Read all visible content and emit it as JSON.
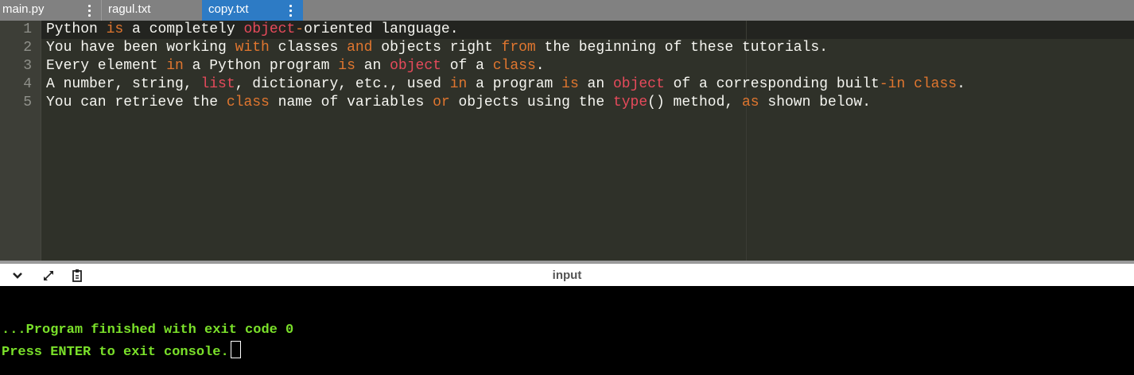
{
  "tabs": [
    {
      "label": "main.py",
      "active": false
    },
    {
      "label": "ragul.txt",
      "active": false
    },
    {
      "label": "copy.txt",
      "active": true
    }
  ],
  "editor": {
    "line_numbers": [
      "1",
      "2",
      "3",
      "4",
      "5"
    ],
    "lines": [
      [
        {
          "t": "Python ",
          "c": "txt"
        },
        {
          "t": "is",
          "c": "kw"
        },
        {
          "t": " a completely ",
          "c": "txt"
        },
        {
          "t": "object",
          "c": "fn"
        },
        {
          "t": "-",
          "c": "kw"
        },
        {
          "t": "oriented language.",
          "c": "txt"
        }
      ],
      [
        {
          "t": "You have been working ",
          "c": "txt"
        },
        {
          "t": "with",
          "c": "kw"
        },
        {
          "t": " classes ",
          "c": "txt"
        },
        {
          "t": "and",
          "c": "kw"
        },
        {
          "t": " objects right ",
          "c": "txt"
        },
        {
          "t": "from",
          "c": "kw"
        },
        {
          "t": " the beginning of these tutorials.",
          "c": "txt"
        }
      ],
      [
        {
          "t": "Every element ",
          "c": "txt"
        },
        {
          "t": "in",
          "c": "kw"
        },
        {
          "t": " a Python program ",
          "c": "txt"
        },
        {
          "t": "is",
          "c": "kw"
        },
        {
          "t": " an ",
          "c": "txt"
        },
        {
          "t": "object",
          "c": "fn"
        },
        {
          "t": " of a ",
          "c": "txt"
        },
        {
          "t": "class",
          "c": "kw"
        },
        {
          "t": ".",
          "c": "txt"
        }
      ],
      [
        {
          "t": "A number, string, ",
          "c": "txt"
        },
        {
          "t": "list",
          "c": "fn"
        },
        {
          "t": ", dictionary, etc., used ",
          "c": "txt"
        },
        {
          "t": "in",
          "c": "kw"
        },
        {
          "t": " a program ",
          "c": "txt"
        },
        {
          "t": "is",
          "c": "kw"
        },
        {
          "t": " an ",
          "c": "txt"
        },
        {
          "t": "object",
          "c": "fn"
        },
        {
          "t": " of a corresponding built",
          "c": "txt"
        },
        {
          "t": "-",
          "c": "kw"
        },
        {
          "t": "in",
          "c": "kw"
        },
        {
          "t": " ",
          "c": "txt"
        },
        {
          "t": "class",
          "c": "kw"
        },
        {
          "t": ".",
          "c": "txt"
        }
      ],
      [
        {
          "t": "You can retrieve the ",
          "c": "txt"
        },
        {
          "t": "class",
          "c": "kw"
        },
        {
          "t": " name of variables ",
          "c": "txt"
        },
        {
          "t": "or",
          "c": "kw"
        },
        {
          "t": " objects using the ",
          "c": "txt"
        },
        {
          "t": "type",
          "c": "fn"
        },
        {
          "t": "() method, ",
          "c": "txt"
        },
        {
          "t": "as",
          "c": "kw"
        },
        {
          "t": " shown below.",
          "c": "txt"
        }
      ]
    ]
  },
  "console": {
    "title": "input",
    "icons": [
      "chevron-down-icon",
      "expand-icon",
      "clipboard-icon"
    ],
    "output_line1": "...Program finished with exit code 0",
    "output_line2": "Press ENTER to exit console."
  },
  "colors": {
    "tab_bar": "#818181",
    "tab_active": "#2d7bc5",
    "editor_bg": "#2f3129",
    "keyword": "#e0762f",
    "builtin": "#e64a5b",
    "console_text": "#7ae02a"
  }
}
